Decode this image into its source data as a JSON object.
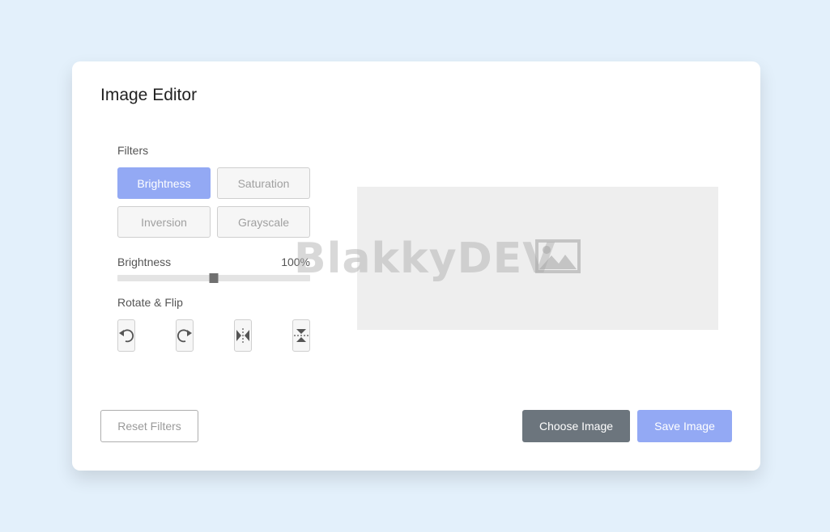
{
  "editor": {
    "title": "Image Editor"
  },
  "filters": {
    "label": "Filters",
    "buttons": [
      {
        "label": "Brightness",
        "active": true
      },
      {
        "label": "Saturation",
        "active": false
      },
      {
        "label": "Inversion",
        "active": false
      },
      {
        "label": "Grayscale",
        "active": false
      }
    ]
  },
  "slider": {
    "name": "Brightness",
    "value": "100%",
    "level": 0.5
  },
  "rotate": {
    "label": "Rotate & Flip",
    "buttons": [
      {
        "icon": "rotate-left-icon"
      },
      {
        "icon": "rotate-right-icon"
      },
      {
        "icon": "flip-horizontal-icon"
      },
      {
        "icon": "flip-vertical-icon"
      }
    ]
  },
  "preview": {
    "placeholder_icon": "image-placeholder-icon",
    "watermark": "BlakkyDEV"
  },
  "actions": {
    "reset_label": "Reset Filters",
    "choose_label": "Choose Image",
    "save_label": "Save Image"
  },
  "colors": {
    "page_background": "#e3f0fb",
    "accent": "#93a9f4",
    "secondary": "#6c757d"
  }
}
